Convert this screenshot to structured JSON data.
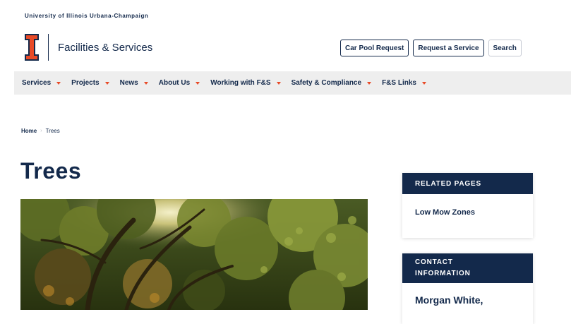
{
  "header": {
    "university": "University of Illinois Urbana-Champaign",
    "site_name": "Facilities & Services",
    "buttons": {
      "car_pool": "Car Pool Request",
      "request_service": "Request a Service",
      "search": "Search"
    }
  },
  "nav": {
    "items": [
      {
        "label": "Services"
      },
      {
        "label": "Projects"
      },
      {
        "label": "News"
      },
      {
        "label": "About Us"
      },
      {
        "label": "Working with F&S"
      },
      {
        "label": "Safety & Compliance"
      },
      {
        "label": "F&S Links"
      }
    ]
  },
  "breadcrumb": {
    "home": "Home",
    "separator": "›",
    "current": "Trees"
  },
  "page": {
    "title": "Trees"
  },
  "sidebar": {
    "related": {
      "heading": "RELATED PAGES",
      "link": "Low Mow Zones"
    },
    "contact": {
      "heading_line1": "CONTACT",
      "heading_line2": "INFORMATION",
      "name": "Morgan White,"
    }
  },
  "colors": {
    "navy": "#13294b",
    "orange": "#e84a27",
    "nav_bg": "#eeeeee"
  }
}
